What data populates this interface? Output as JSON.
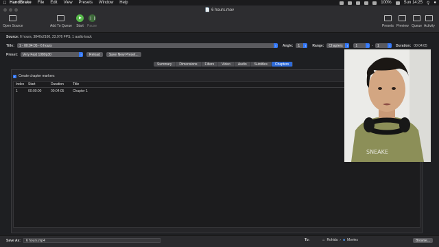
{
  "menubar": {
    "items": [
      "HandBrake",
      "File",
      "Edit",
      "View",
      "Presets",
      "Window",
      "Help"
    ],
    "battery": "100%",
    "clock": "Sun 14:25"
  },
  "window": {
    "title": "6 hours.mov"
  },
  "toolbar": {
    "open_source": "Open Source",
    "add_to_queue": "Add To Queue",
    "start": "Start",
    "pause": "Pause",
    "presets": "Presets",
    "preview": "Preview",
    "queue": "Queue",
    "activity": "Activity"
  },
  "source": {
    "label": "Source:",
    "value": "6 hours, 3840x2160, 23.976 FPS, 1 audio track"
  },
  "title_row": {
    "label": "Title:",
    "value": "1 - 00:04:05 - 6 hours",
    "angle_label": "Angle:",
    "angle_value": "1",
    "range_label": "Range:",
    "range_value": "Chapters",
    "range_from": "1",
    "range_sep": "-",
    "range_to": "1",
    "duration_label": "Duration:",
    "duration_value": "00:04:05"
  },
  "preset_row": {
    "label": "Preset:",
    "value": "Very Fast 1080p30",
    "reload": "Reload",
    "save_new": "Save New Preset..."
  },
  "tabs": [
    "Summary",
    "Dimensions",
    "Filters",
    "Video",
    "Audio",
    "Subtitles",
    "Chapters"
  ],
  "active_tab": "Chapters",
  "chapters": {
    "create_markers_label": "Create chapter markers",
    "create_markers_checked": true,
    "columns": [
      "Index",
      "Start",
      "Duration",
      "Title"
    ],
    "rows": [
      {
        "index": "1",
        "start": "00:00:00",
        "duration": "00:04:05",
        "title": "Chapter 1"
      }
    ]
  },
  "save": {
    "label": "Save As:",
    "value": "6 hours.mp4",
    "to_label": "To:",
    "path_user": "Rohida",
    "path_folder": "Movies",
    "browse": "Browse..."
  },
  "colors": {
    "accent": "#3478f6",
    "start_green": "#57b94a",
    "window_bg": "#1e1f22"
  }
}
